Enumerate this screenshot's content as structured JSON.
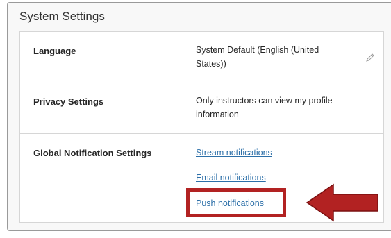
{
  "panel": {
    "title": "System Settings"
  },
  "settings": {
    "language": {
      "label": "Language",
      "value": "System Default (English (United States))"
    },
    "privacy": {
      "label": "Privacy Settings",
      "value": "Only instructors can view my profile information"
    },
    "notifications": {
      "label": "Global Notification Settings",
      "links": [
        "Stream notifications",
        "Email notifications",
        "Push notifications"
      ]
    }
  },
  "icons": {
    "edit": "pencil-icon",
    "annotation": "arrow-left-icon"
  },
  "colors": {
    "link": "#2c6fa8",
    "annotation": "#b22222"
  }
}
